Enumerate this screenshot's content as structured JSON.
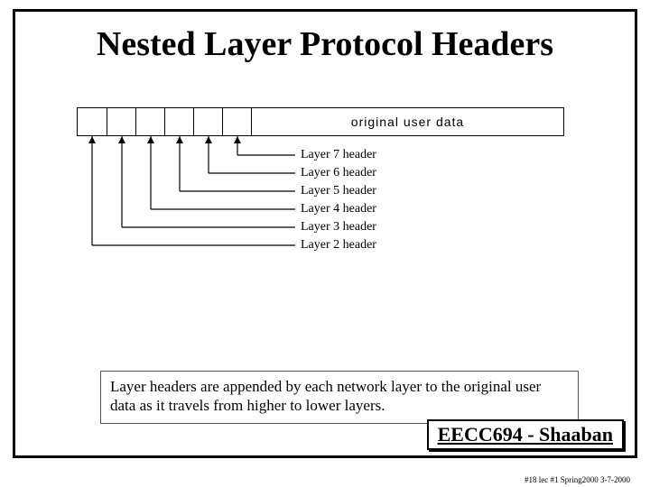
{
  "title": "Nested Layer Protocol Headers",
  "diagram": {
    "user_data_label": "original user data",
    "layers": [
      {
        "name": "Layer 7 header"
      },
      {
        "name": "Layer 6 header"
      },
      {
        "name": "Layer 5 header"
      },
      {
        "name": "Layer 4 header"
      },
      {
        "name": "Layer 3 header"
      },
      {
        "name": "Layer 2 header"
      }
    ]
  },
  "caption": "Layer headers are appended by each network layer to the original user data as it travels from higher to lower layers.",
  "course": "EECC694 - Shaaban",
  "footer": "#18 lec #1   Spring2000  3-7-2000"
}
